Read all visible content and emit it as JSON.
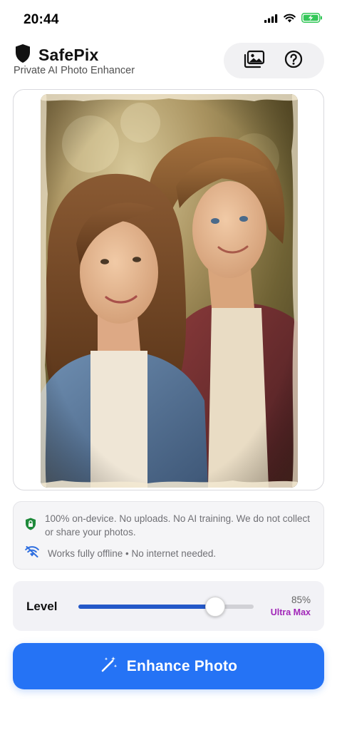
{
  "status_bar": {
    "time": "20:44",
    "icons": [
      "cellular-signal-icon",
      "wifi-icon",
      "battery-charging-icon"
    ],
    "battery_color": "#34c759"
  },
  "header": {
    "logo_icon": "shield-icon",
    "app_name": "SafePix",
    "tagline": "Private AI Photo Enhancer",
    "actions": [
      "gallery-icon",
      "help-icon"
    ]
  },
  "photo": {
    "content": "vintage-couple-portrait-image"
  },
  "privacy": {
    "line1": "100% on-device. No uploads. No AI training. We do not collect or share your photos.",
    "line1_icon": "lock-shield-icon",
    "line1_icon_color": "#1f8a3b",
    "line2": "Works fully offline • No internet needed.",
    "line2_icon": "wifi-off-icon",
    "line2_icon_color": "#2f6fe0"
  },
  "level": {
    "label": "Level",
    "value_text": "85%",
    "value_fraction": 0.78,
    "mode": "Ultra Max",
    "fill_color": "#2458c8",
    "mode_color": "#a126b8"
  },
  "enhance_button": {
    "label": "Enhance Photo",
    "icon": "magic-wand-icon",
    "color": "#2573f5"
  }
}
